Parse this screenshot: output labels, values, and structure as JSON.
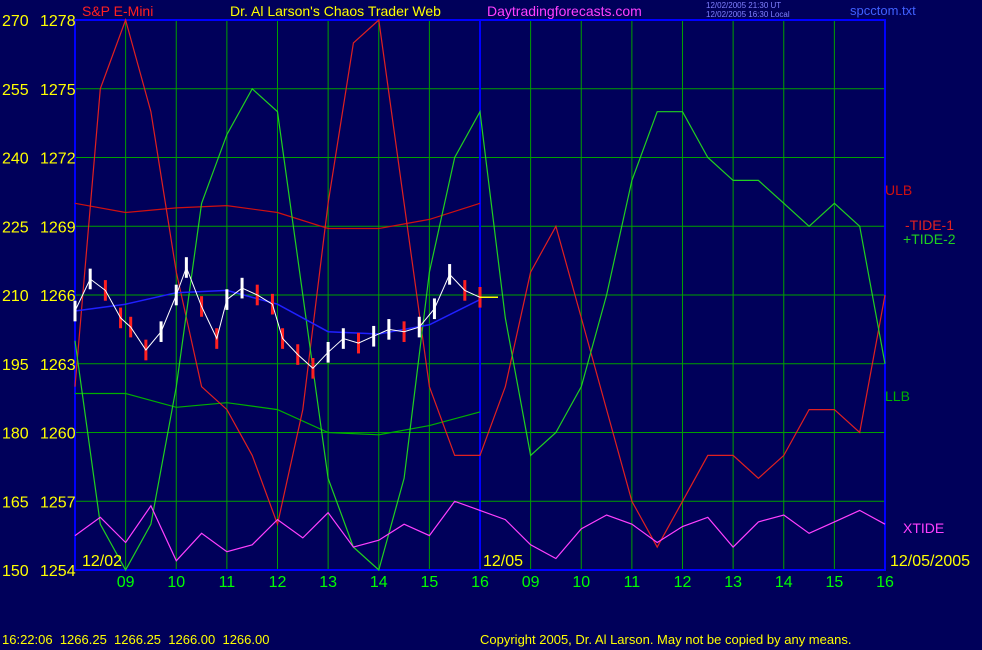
{
  "header": {
    "instrument": "S&P E-Mini",
    "title": "Dr. Al Larson's Chaos Trader Web",
    "site": "Daytradingforecasts.com",
    "timestamp_ut": "12/02/2005 21:30 UT",
    "timestamp_local": "12/02/2005 16:30 Local",
    "file": "spcctom.txt"
  },
  "footer": {
    "quote": "16:22:06  1266.25  1266.25  1266.00  1266.00",
    "copyright": "Copyright 2005, Dr. Al Larson. May not be copied by any means."
  },
  "colors": {
    "background": "#00005a",
    "frame": "#0000ff",
    "grid": "#00a000",
    "tick_labels": "#ffff00",
    "x_labels": "#00ff00",
    "date_labels": "#ffff00",
    "ulb": "#d01010",
    "llb": "#00b000",
    "tide1": "#e02020",
    "tide2": "#20d020",
    "xtide": "#ff40ff",
    "price_up": "#ffffff",
    "price_down": "#ff2020",
    "avg": "#2020ff"
  },
  "chart_data": {
    "type": "line",
    "x_axis": {
      "hours_day1": [
        "09",
        "10",
        "11",
        "12",
        "13",
        "14",
        "15",
        "16"
      ],
      "hours_day2": [
        "09",
        "10",
        "11",
        "12",
        "13",
        "14",
        "15",
        "16"
      ],
      "date_labels": [
        "12/02",
        "12/05",
        "12/05/2005"
      ]
    },
    "y_axis_left_tide": {
      "ticks": [
        270,
        255,
        240,
        225,
        210,
        195,
        180,
        165,
        150
      ],
      "range": [
        150,
        270
      ]
    },
    "y_axis_left_price": {
      "ticks": [
        1278,
        1275,
        1272,
        1269,
        1266,
        1263,
        1260,
        1257,
        1254
      ],
      "range": [
        1254,
        1278
      ]
    },
    "series_labels": {
      "ulb": "ULB",
      "tide1": "-TIDE-1",
      "tide2": "+TIDE-2",
      "llb": "LLB",
      "xtide": "XTIDE"
    },
    "grid": true,
    "series": [
      {
        "name": "ULB",
        "x": [
          8.0,
          9.0,
          10.0,
          11.0,
          12.0,
          13.0,
          14.0,
          15.0,
          16.0
        ],
        "values": [
          1270.0,
          1269.6,
          1269.8,
          1269.9,
          1269.6,
          1268.9,
          1268.9,
          1269.3,
          1270.0
        ]
      },
      {
        "name": "LLB",
        "x": [
          8.0,
          9.0,
          10.0,
          11.0,
          12.0,
          13.0,
          14.0,
          15.0,
          16.0
        ],
        "values": [
          1261.7,
          1261.7,
          1261.1,
          1261.3,
          1261.0,
          1260.0,
          1259.9,
          1260.3,
          1260.9
        ]
      },
      {
        "name": "-TIDE-1",
        "x": [
          8.0,
          8.5,
          9.0,
          9.5,
          10.0,
          10.5,
          11.0,
          11.5,
          12.0,
          12.5,
          13.0,
          13.5,
          14.0,
          14.5,
          15.0,
          15.5,
          16.0,
          16.5,
          17.0,
          17.5,
          18.0,
          18.5,
          19.0,
          19.5,
          20.0,
          20.5,
          21.0,
          21.5,
          22.0,
          22.5,
          23.0,
          23.5,
          24.0
        ],
        "values": [
          1262,
          1275,
          1278,
          1274,
          1267,
          1262,
          1261,
          1259,
          1256,
          1261,
          1270,
          1277,
          1278,
          1270,
          1262,
          1259,
          1259,
          1262,
          1267,
          1269,
          1265,
          1261,
          1257,
          1255,
          1257,
          1259,
          1259,
          1258,
          1259,
          1261,
          1261,
          1260,
          1266
        ]
      },
      {
        "name": "+TIDE-2",
        "x": [
          8.0,
          8.5,
          9.0,
          9.5,
          10.0,
          10.5,
          11.0,
          11.5,
          12.0,
          12.5,
          13.0,
          13.5,
          14.0,
          14.5,
          15.0,
          15.5,
          16.0,
          16.5,
          17.0,
          17.5,
          18.0,
          18.5,
          19.0,
          19.5,
          20.0,
          20.5,
          21.0,
          21.5,
          22.0,
          22.5,
          23.0,
          23.5,
          24.0
        ],
        "values": [
          1264,
          1256,
          1254,
          1256,
          1262,
          1270,
          1273,
          1275,
          1274,
          1266,
          1258,
          1255,
          1254,
          1258,
          1267,
          1272,
          1274,
          1265,
          1259,
          1260,
          1262,
          1266,
          1271,
          1274,
          1274,
          1272,
          1271,
          1271,
          1270,
          1269,
          1270,
          1269,
          1263
        ]
      },
      {
        "name": "XTIDE",
        "x": [
          8.0,
          8.5,
          9.0,
          9.5,
          10.0,
          10.5,
          11.0,
          11.5,
          12.0,
          12.5,
          13.0,
          13.5,
          14.0,
          14.5,
          15.0,
          15.5,
          16.0,
          16.5,
          17.0,
          17.5,
          18.0,
          18.5,
          19.0,
          19.5,
          20.0,
          20.5,
          21.0,
          21.5,
          22.0,
          22.5,
          23.0,
          23.5,
          24.0
        ],
        "values": [
          1255.5,
          1256.3,
          1255.2,
          1256.8,
          1254.4,
          1255.6,
          1254.8,
          1255.1,
          1256.2,
          1255.4,
          1256.5,
          1255.0,
          1255.3,
          1256.0,
          1255.5,
          1257.0,
          1256.6,
          1256.2,
          1255.1,
          1254.5,
          1255.8,
          1256.4,
          1256.0,
          1255.2,
          1255.9,
          1256.3,
          1255.0,
          1256.1,
          1256.4,
          1255.6,
          1256.1,
          1256.6,
          1256.0
        ]
      },
      {
        "name": "Price",
        "x": [
          8.0,
          8.3,
          8.6,
          8.9,
          9.1,
          9.4,
          9.7,
          10.0,
          10.2,
          10.5,
          10.8,
          11.0,
          11.3,
          11.6,
          11.9,
          12.1,
          12.4,
          12.7,
          13.0,
          13.3,
          13.6,
          13.9,
          14.2,
          14.5,
          14.8,
          15.1,
          15.4,
          15.7,
          16.0
        ],
        "values": [
          1265.3,
          1266.7,
          1266.2,
          1265.0,
          1264.6,
          1263.6,
          1264.4,
          1266.0,
          1267.2,
          1265.5,
          1264.1,
          1265.8,
          1266.3,
          1266.0,
          1265.6,
          1264.1,
          1263.4,
          1262.8,
          1263.5,
          1264.1,
          1263.9,
          1264.2,
          1264.5,
          1264.4,
          1264.6,
          1265.4,
          1266.9,
          1266.2,
          1265.9
        ]
      },
      {
        "name": "Average",
        "x": [
          8.0,
          9.0,
          10.0,
          11.0,
          12.0,
          13.0,
          14.0,
          15.0,
          16.0
        ],
        "values": [
          1265.3,
          1265.6,
          1266.1,
          1266.2,
          1265.6,
          1264.4,
          1264.3,
          1264.7,
          1265.8
        ]
      }
    ]
  }
}
